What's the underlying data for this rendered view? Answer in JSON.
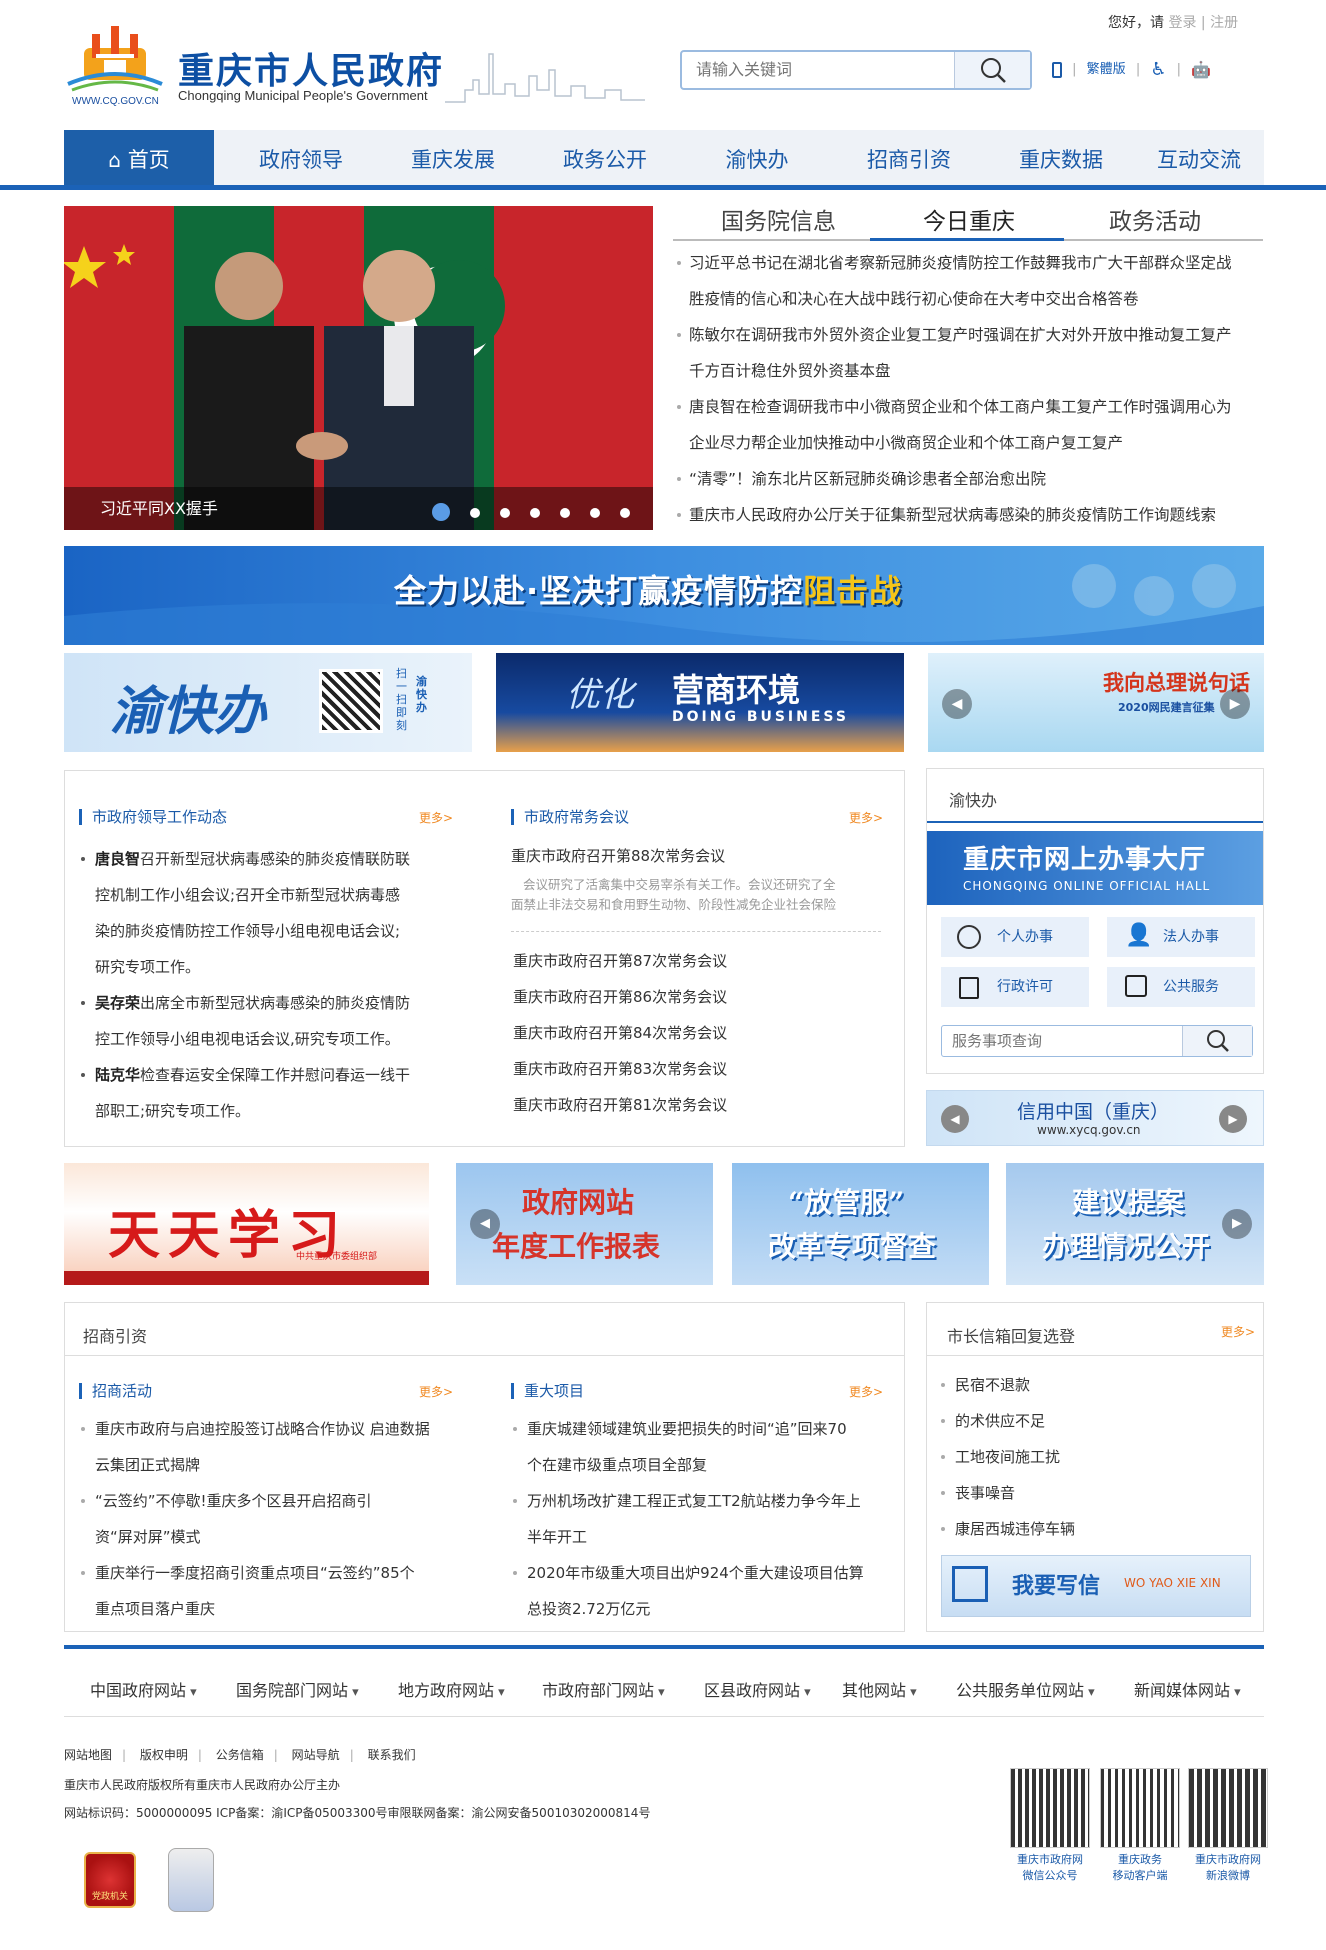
{
  "header": {
    "site_title": "重庆市人民政府",
    "site_subtitle": "Chongqing Municipal People's Government",
    "logo_url_text": "WWW.CQ.GOV.CN",
    "greeting": "您好，请",
    "login": "登录",
    "register": "注册",
    "search_placeholder": "请输入关键词",
    "traditional": "繁體版"
  },
  "nav": {
    "items": [
      "首页",
      "政府领导",
      "重庆发展",
      "政务公开",
      "渝快办",
      "招商引资",
      "重庆数据",
      "互动交流"
    ]
  },
  "slider": {
    "caption": "习近平同XX握手",
    "dot_count": 7,
    "active_dot": 0
  },
  "news_tabs": {
    "tabs": [
      "国务院信息",
      "今日重庆",
      "政务活动"
    ],
    "active": 1,
    "items": [
      "习近平总书记在湖北省考察新冠肺炎疫情防控工作鼓舞我市广大干部群众坚定战",
      "胜疫情的信心和决心在大战中践行初心使命在大考中交出合格答卷",
      "陈敏尔在调研我市外贸外资企业复工复产时强调在扩大对外开放中推动复工复产",
      "千方百计稳住外贸外资基本盘",
      "唐良智在检查调研我市中小微商贸企业和个体工商户集工复产工作时强调用心为",
      "企业尽力帮企业加快推动中小微商贸企业和个体工商户复工复产",
      "“清零”！渝东北片区新冠肺炎确诊患者全部治愈出院",
      "重庆市人民政府办公厅关于征集新型冠状病毒感染的肺炎疫情防工作询题线索"
    ]
  },
  "banner": {
    "text_main": "全力以赴·坚决打赢疫情防控",
    "text_accent": "阻击战"
  },
  "promos": {
    "yukuaiban": "渝快办",
    "yukuaiban_side": "扫一扫即刻",
    "yukuaiban_side2": "渝快办",
    "business": "营商环境",
    "business_prefix": "优化",
    "business_en": "DOING BUSINESS",
    "premier": "我向总理说句话",
    "premier_sub": "2020网民建言征集"
  },
  "leaders": {
    "title": "市政府领导工作动态",
    "more": "更多>",
    "items": [
      {
        "name": "唐良智",
        "lines": [
          "召开新型冠状病毒感染的肺炎疫情联防联",
          "控机制工作小组会议;召开全市新型冠状病毒感",
          "染的肺炎疫情防控工作领导小组电视电话会议;",
          "研究专项工作。"
        ]
      },
      {
        "name": "吴存荣",
        "lines": [
          "出席全市新型冠状病毒感染的肺炎疫情防",
          "控工作领导小组电视电话会议,研究专项工作。"
        ]
      },
      {
        "name": "陆克华",
        "lines": [
          "检查春运安全保障工作并慰问春运一线干",
          "部职工;研究专项工作。"
        ]
      }
    ]
  },
  "meetings": {
    "title": "市政府常务会议",
    "more": "更多>",
    "headline": "重庆市政府召开第88次常务会议",
    "summary1": "会议研究了活禽集中交易宰杀有关工作。会议还研究了全",
    "summary2": "面禁止非法交易和食用野生动物、阶段性减免企业社会保险",
    "items": [
      "重庆市政府召开第87次常务会议",
      "重庆市政府召开第86次常务会议",
      "重庆市政府召开第84次常务会议",
      "重庆市政府召开第83次常务会议",
      "重庆市政府召开第81次常务会议"
    ]
  },
  "yukuaiban_panel": {
    "title": "渝快办",
    "hall_title": "重庆市网上办事大厅",
    "hall_en": "CHONGQING ONLINE OFFICIAL HALL",
    "buttons": [
      "个人办事",
      "法人办事",
      "行政许可",
      "公共服务"
    ],
    "search_placeholder": "服务事项查询"
  },
  "credit": {
    "title": "信用中国（重庆）",
    "url": "www.xycq.gov.cn"
  },
  "bottom_promos": {
    "study": "天天学习",
    "study_sub": "中共重庆市委组织部",
    "report1": "政府网站",
    "report2": "年度工作报表",
    "reform1": "“放管服”",
    "reform2": "改革专项督查",
    "proposal1": "建议提案",
    "proposal2": "办理情况公开"
  },
  "investment": {
    "title": "招商引资",
    "activities_title": "招商活动",
    "activities_more": "更多>",
    "activities": [
      [
        "重庆市政府与启迪控股签订战略合作协议 启迪数据",
        "云集团正式揭牌"
      ],
      [
        "“云签约”不停歇!重庆多个区县开启招商引",
        "资“屏对屏”模式"
      ],
      [
        "重庆举行一季度招商引资重点项目“云签约”85个",
        "重点项目落户重庆"
      ]
    ],
    "projects_title": "重大项目",
    "projects_more": "更多>",
    "projects": [
      [
        "重庆城建领域建筑业要把损失的时间“追”回来70",
        "个在建市级重点项目全部复"
      ],
      [
        "万州机场改扩建工程正式复工T2航站楼力争今年上",
        "半年开工"
      ],
      [
        "2020年市级重大项目出炉924个重大建设项目估算",
        "总投资2.72万亿元"
      ]
    ]
  },
  "mayor": {
    "title": "市长信箱回复选登",
    "more": "更多>",
    "items": [
      "民宿不退款",
      "的术供应不足",
      "工地夜间施工扰",
      "丧事噪音",
      "康居西城违停车辆"
    ],
    "write_cn": "我要写信",
    "write_en": "WO YAO XIE XIN"
  },
  "footer_nav": {
    "items": [
      "中国政府网站",
      "国务院部门网站",
      "地方政府网站",
      "市政府部门网站",
      "区县政府网站",
      "其他网站",
      "公共服务单位网站",
      "新闻媒体网站"
    ]
  },
  "footer": {
    "links": [
      "网站地图",
      "版权申明",
      "公务信箱",
      "网站导航",
      "联系我们"
    ],
    "host": "重庆市人民政府版权所有重庆市人民政府办公厅主办",
    "ids": "网站标识码：5000000095  ICP备案：渝ICP备05003300号审限联网备案：渝公网安备50010302000814号",
    "qr_captions": [
      [
        "重庆市政府网",
        "微信公众号"
      ],
      [
        "重庆政务",
        "移动客户端"
      ],
      [
        "重庆市政府网",
        "新浪微博"
      ]
    ],
    "badge": "党政机关"
  },
  "colors": {
    "primary": "#1b62b7",
    "nav_bg": "#eef2f7",
    "more": "#f08a24"
  }
}
